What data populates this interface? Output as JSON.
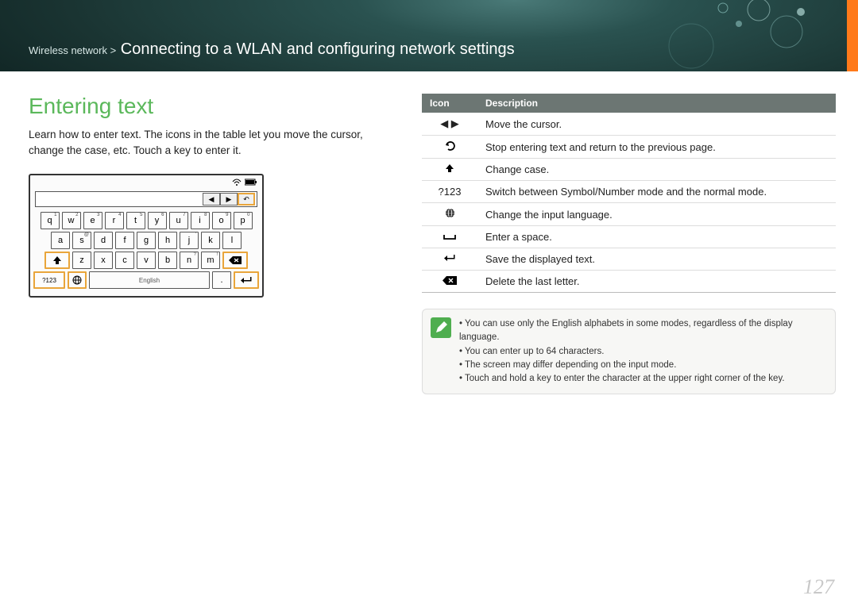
{
  "header": {
    "breadcrumb_prefix": "Wireless network >",
    "title": "Connecting to a WLAN and configuring network settings"
  },
  "section_title": "Entering text",
  "intro": "Learn how to enter text. The icons in the table let you move the cursor, change the case, etc. Touch a key to enter it.",
  "keyboard": {
    "row1": [
      {
        "k": "q",
        "s": "1"
      },
      {
        "k": "w",
        "s": "2"
      },
      {
        "k": "e",
        "s": "3"
      },
      {
        "k": "r",
        "s": "4"
      },
      {
        "k": "t",
        "s": "5"
      },
      {
        "k": "y",
        "s": "6"
      },
      {
        "k": "u",
        "s": "7"
      },
      {
        "k": "i",
        "s": "8"
      },
      {
        "k": "o",
        "s": "9"
      },
      {
        "k": "p",
        "s": "0"
      }
    ],
    "row2": [
      {
        "k": "a",
        "s": ""
      },
      {
        "k": "s",
        "s": "@"
      },
      {
        "k": "d",
        "s": ""
      },
      {
        "k": "f",
        "s": ""
      },
      {
        "k": "g",
        "s": ""
      },
      {
        "k": "h",
        "s": ""
      },
      {
        "k": "j",
        "s": "'"
      },
      {
        "k": "k",
        "s": ""
      },
      {
        "k": "l",
        "s": ""
      }
    ],
    "row3_letters": [
      {
        "k": "z",
        "s": ""
      },
      {
        "k": "x",
        "s": ""
      },
      {
        "k": "c",
        "s": ""
      },
      {
        "k": "v",
        "s": ""
      },
      {
        "k": "b",
        "s": ""
      },
      {
        "k": "n",
        "s": "?"
      },
      {
        "k": "m",
        "s": "!"
      }
    ],
    "sym_label": "?123",
    "space_label": "English",
    "period": "."
  },
  "table": {
    "header_icon": "Icon",
    "header_desc": "Description",
    "rows": [
      {
        "icon": "◀ ▶",
        "desc": "Move the cursor."
      },
      {
        "icon": "↩",
        "icon_name": "back-icon",
        "desc": "Stop entering text and return to the previous page."
      },
      {
        "icon": "⬆",
        "icon_name": "shift-icon",
        "desc": "Change case."
      },
      {
        "icon": "?123",
        "icon_name": "symbol-mode-icon",
        "desc": "Switch between Symbol/Number mode and the normal mode."
      },
      {
        "icon": "⊕",
        "icon_name": "globe-icon",
        "desc": "Change the input language."
      },
      {
        "icon": "⎵",
        "icon_name": "space-icon",
        "desc": "Enter a space."
      },
      {
        "icon": "↵",
        "icon_name": "enter-icon",
        "desc": "Save the displayed text."
      },
      {
        "icon": "⌫",
        "icon_name": "backspace-icon",
        "desc": "Delete the last letter."
      }
    ]
  },
  "notes": [
    "You can use only the English alphabets in some modes, regardless of the display language.",
    "You can enter up to 64 characters.",
    "The screen may differ depending on the input mode.",
    "Touch and hold a key to enter the character at the upper right corner of the key."
  ],
  "page_number": "127"
}
